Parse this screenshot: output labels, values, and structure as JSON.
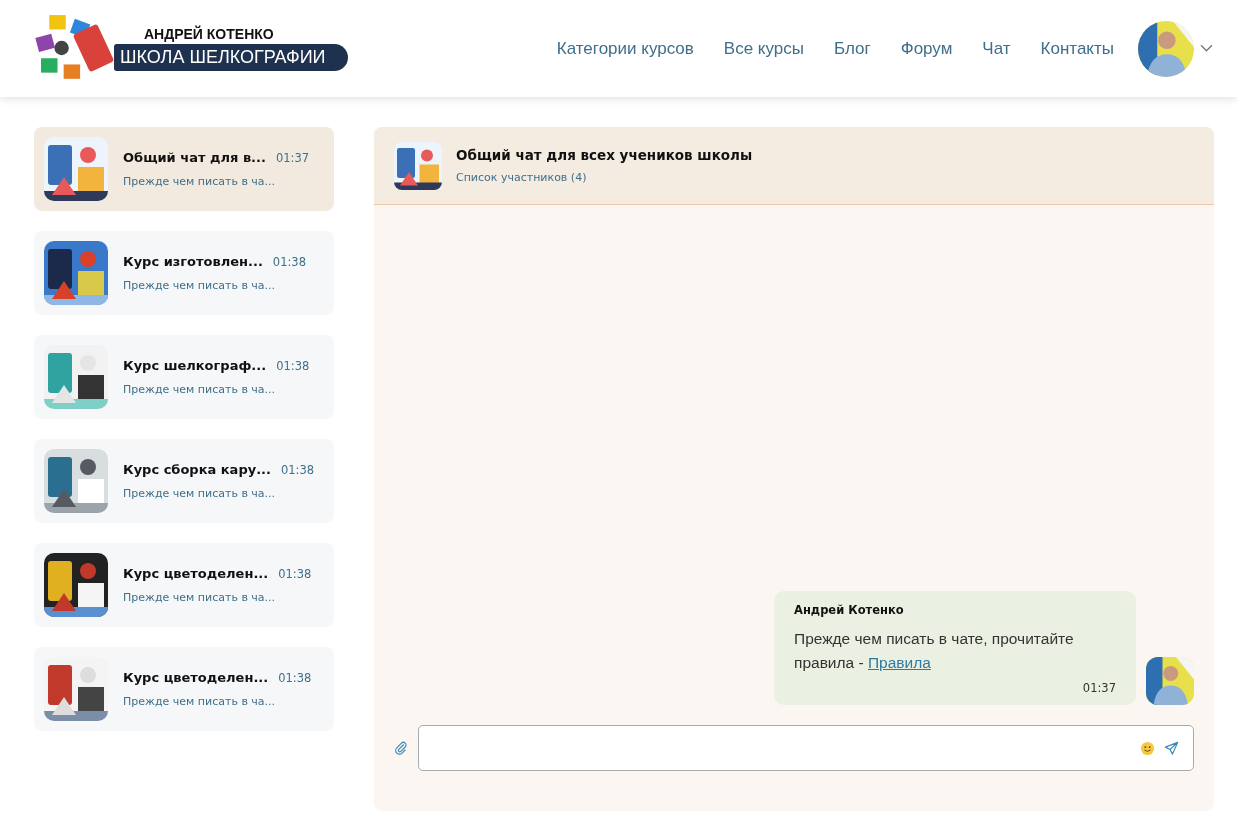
{
  "logo": {
    "top_line": "АНДРЕЙ КОТЕНКО",
    "bottom_line": "ШКОЛА ШЕЛКОГРАФИИ"
  },
  "nav": [
    {
      "label": "Категории курсов"
    },
    {
      "label": "Все курсы"
    },
    {
      "label": "Блог"
    },
    {
      "label": "Форум"
    },
    {
      "label": "Чат"
    },
    {
      "label": "Контакты"
    }
  ],
  "chats": [
    {
      "title": "Общий чат для в...",
      "time": "01:37",
      "preview": "Прежде чем писать в ча...",
      "selected": true
    },
    {
      "title": "Курс изготовлен...",
      "time": "01:38",
      "preview": "Прежде чем писать в ча...",
      "selected": false
    },
    {
      "title": "Курс шелкограф...",
      "time": "01:38",
      "preview": "Прежде чем писать в ча...",
      "selected": false
    },
    {
      "title": "Курс сборка кару...",
      "time": "01:38",
      "preview": "Прежде чем писать в ча...",
      "selected": false
    },
    {
      "title": "Курс цветоделен...",
      "time": "01:38",
      "preview": "Прежде чем писать в ча...",
      "selected": false
    },
    {
      "title": "Курс цветоделен...",
      "time": "01:38",
      "preview": "Прежде чем писать в ча...",
      "selected": false
    }
  ],
  "conversation": {
    "title": "Общий чат для всех учеников школы",
    "members_link": "Список участников (4)",
    "messages": [
      {
        "author": "Андрей Котенко",
        "text": "Прежде чем писать в чате, прочитайте правила - ",
        "link": "Правила",
        "time": "01:37"
      }
    ]
  }
}
